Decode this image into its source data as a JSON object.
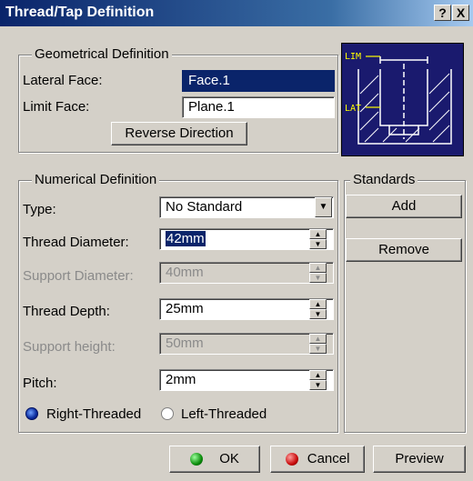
{
  "window": {
    "title": "Thread/Tap Definition",
    "help_label": "?",
    "close_label": "X"
  },
  "geometrical": {
    "group_title": "Geometrical Definition",
    "lateral_face_label": "Lateral Face:",
    "lateral_face_value": "Face.1",
    "limit_face_label": "Limit Face:",
    "limit_face_value": "Plane.1",
    "reverse_label": "Reverse Direction"
  },
  "preview_image": {
    "lim_label": "LIM",
    "lat_label": "LAT"
  },
  "numerical": {
    "group_title": "Numerical Definition",
    "type_label": "Type:",
    "type_value": "No Standard",
    "thread_diameter_label": "Thread Diameter:",
    "thread_diameter_value": "42mm",
    "support_diameter_label": "Support Diameter:",
    "support_diameter_value": "40mm",
    "thread_depth_label": "Thread Depth:",
    "thread_depth_value": "25mm",
    "support_height_label": "Support height:",
    "support_height_value": "50mm",
    "pitch_label": "Pitch:",
    "pitch_value": "2mm",
    "right_threaded_label": "Right-Threaded",
    "left_threaded_label": "Left-Threaded"
  },
  "standards": {
    "group_title": "Standards",
    "add_label": "Add",
    "remove_label": "Remove"
  },
  "footer": {
    "ok_label": "OK",
    "cancel_label": "Cancel",
    "preview_label": "Preview"
  },
  "colors": {
    "title_bar": "#0a246a",
    "preview_bg": "#1a1a6e",
    "preview_lines": "#ffffff",
    "preview_labels": "#ffff00"
  }
}
